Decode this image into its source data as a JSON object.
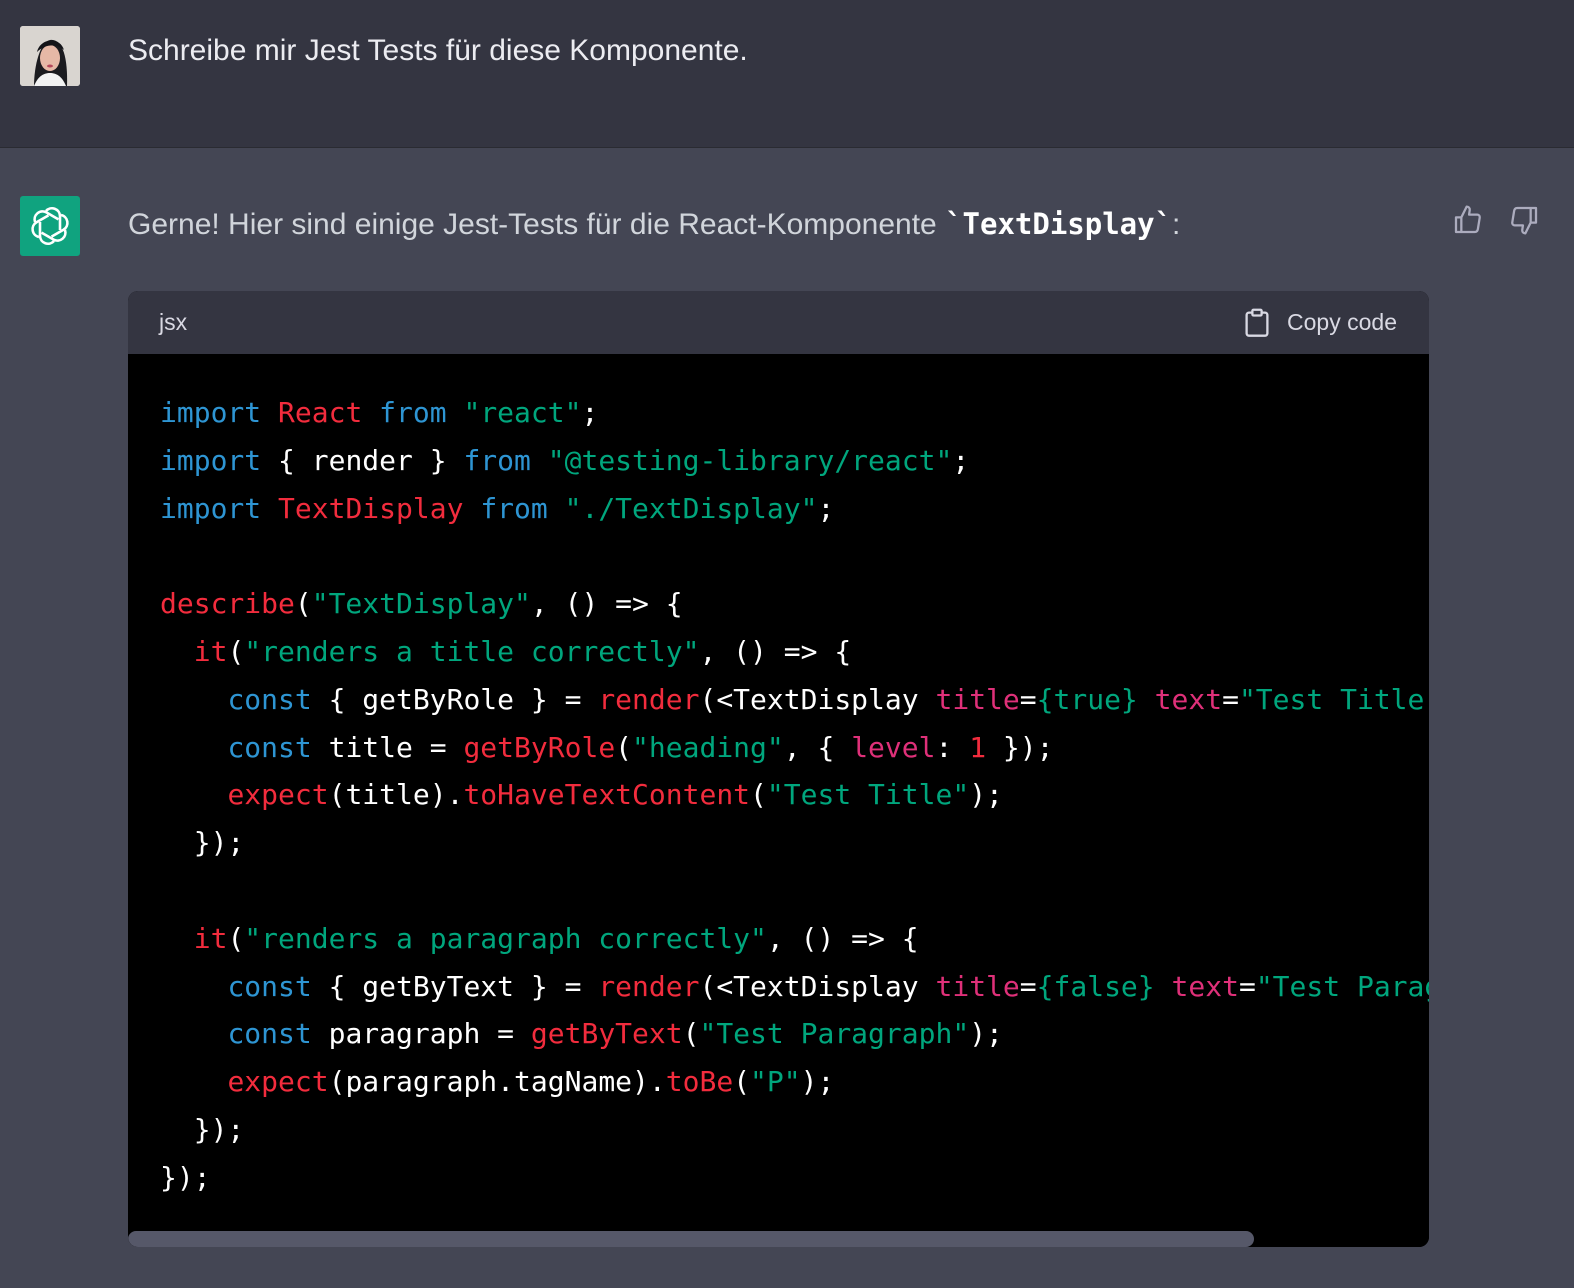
{
  "user": {
    "avatar": "user-photo",
    "message": "Schreibe mir Jest Tests für diese Komponente."
  },
  "assistant": {
    "avatar": "openai-logo-icon",
    "intro_prefix": "Gerne! Hier sind einige Jest-Tests für die React-Komponente ",
    "intro_code": "`TextDisplay`",
    "intro_suffix": ":",
    "thumbs_up": "thumbs-up-icon",
    "thumbs_down": "thumbs-down-icon"
  },
  "codeblock": {
    "language": "jsx",
    "copy_label": "Copy code",
    "lines": [
      [
        [
          "k",
          "import"
        ],
        [
          "w",
          " "
        ],
        [
          "n",
          "React"
        ],
        [
          "w",
          " "
        ],
        [
          "k",
          "from"
        ],
        [
          "w",
          " "
        ],
        [
          "s",
          "\"react\""
        ],
        [
          "w",
          ";"
        ]
      ],
      [
        [
          "k",
          "import"
        ],
        [
          "w",
          " { render } "
        ],
        [
          "k",
          "from"
        ],
        [
          "w",
          " "
        ],
        [
          "s",
          "\"@testing-library/react\""
        ],
        [
          "w",
          ";"
        ]
      ],
      [
        [
          "k",
          "import"
        ],
        [
          "w",
          " "
        ],
        [
          "n",
          "TextDisplay"
        ],
        [
          "w",
          " "
        ],
        [
          "k",
          "from"
        ],
        [
          "w",
          " "
        ],
        [
          "s",
          "\"./TextDisplay\""
        ],
        [
          "w",
          ";"
        ]
      ],
      [],
      [
        [
          "n",
          "describe"
        ],
        [
          "w",
          "("
        ],
        [
          "s",
          "\"TextDisplay\""
        ],
        [
          "w",
          ", () => {"
        ]
      ],
      [
        [
          "w",
          "  "
        ],
        [
          "n",
          "it"
        ],
        [
          "w",
          "("
        ],
        [
          "s",
          "\"renders a title correctly\""
        ],
        [
          "w",
          ", () => {"
        ]
      ],
      [
        [
          "w",
          "    "
        ],
        [
          "k",
          "const"
        ],
        [
          "w",
          " { getByRole } = "
        ],
        [
          "n",
          "render"
        ],
        [
          "w",
          "(<TextDisplay "
        ],
        [
          "a",
          "title"
        ],
        [
          "w",
          "="
        ],
        [
          "s",
          "{true}"
        ],
        [
          "w",
          " "
        ],
        [
          "a",
          "text"
        ],
        [
          "w",
          "="
        ],
        [
          "s",
          "\"Test Title\""
        ],
        [
          "w",
          " />);"
        ]
      ],
      [
        [
          "w",
          "    "
        ],
        [
          "k",
          "const"
        ],
        [
          "w",
          " title = "
        ],
        [
          "n",
          "getByRole"
        ],
        [
          "w",
          "("
        ],
        [
          "s",
          "\"heading\""
        ],
        [
          "w",
          ", { "
        ],
        [
          "a",
          "level"
        ],
        [
          "w",
          ": "
        ],
        [
          "n",
          "1"
        ],
        [
          "w",
          " });"
        ]
      ],
      [
        [
          "w",
          "    "
        ],
        [
          "n",
          "expect"
        ],
        [
          "w",
          "(title)."
        ],
        [
          "n",
          "toHaveTextContent"
        ],
        [
          "w",
          "("
        ],
        [
          "s",
          "\"Test Title\""
        ],
        [
          "w",
          ");"
        ]
      ],
      [
        [
          "w",
          "  });"
        ]
      ],
      [],
      [
        [
          "w",
          "  "
        ],
        [
          "n",
          "it"
        ],
        [
          "w",
          "("
        ],
        [
          "s",
          "\"renders a paragraph correctly\""
        ],
        [
          "w",
          ", () => {"
        ]
      ],
      [
        [
          "w",
          "    "
        ],
        [
          "k",
          "const"
        ],
        [
          "w",
          " { getByText } = "
        ],
        [
          "n",
          "render"
        ],
        [
          "w",
          "(<TextDisplay "
        ],
        [
          "a",
          "title"
        ],
        [
          "w",
          "="
        ],
        [
          "s",
          "{false}"
        ],
        [
          "w",
          " "
        ],
        [
          "a",
          "text"
        ],
        [
          "w",
          "="
        ],
        [
          "s",
          "\"Test Paragraph\""
        ],
        [
          "w",
          " />);"
        ]
      ],
      [
        [
          "w",
          "    "
        ],
        [
          "k",
          "const"
        ],
        [
          "w",
          " paragraph = "
        ],
        [
          "n",
          "getByText"
        ],
        [
          "w",
          "("
        ],
        [
          "s",
          "\"Test Paragraph\""
        ],
        [
          "w",
          ");"
        ]
      ],
      [
        [
          "w",
          "    "
        ],
        [
          "n",
          "expect"
        ],
        [
          "w",
          "(paragraph.tagName)."
        ],
        [
          "n",
          "toBe"
        ],
        [
          "w",
          "("
        ],
        [
          "s",
          "\"P\""
        ],
        [
          "w",
          ");"
        ]
      ],
      [
        [
          "w",
          "  });"
        ]
      ],
      [
        [
          "w",
          "});"
        ]
      ]
    ],
    "scroll_position": 0
  }
}
